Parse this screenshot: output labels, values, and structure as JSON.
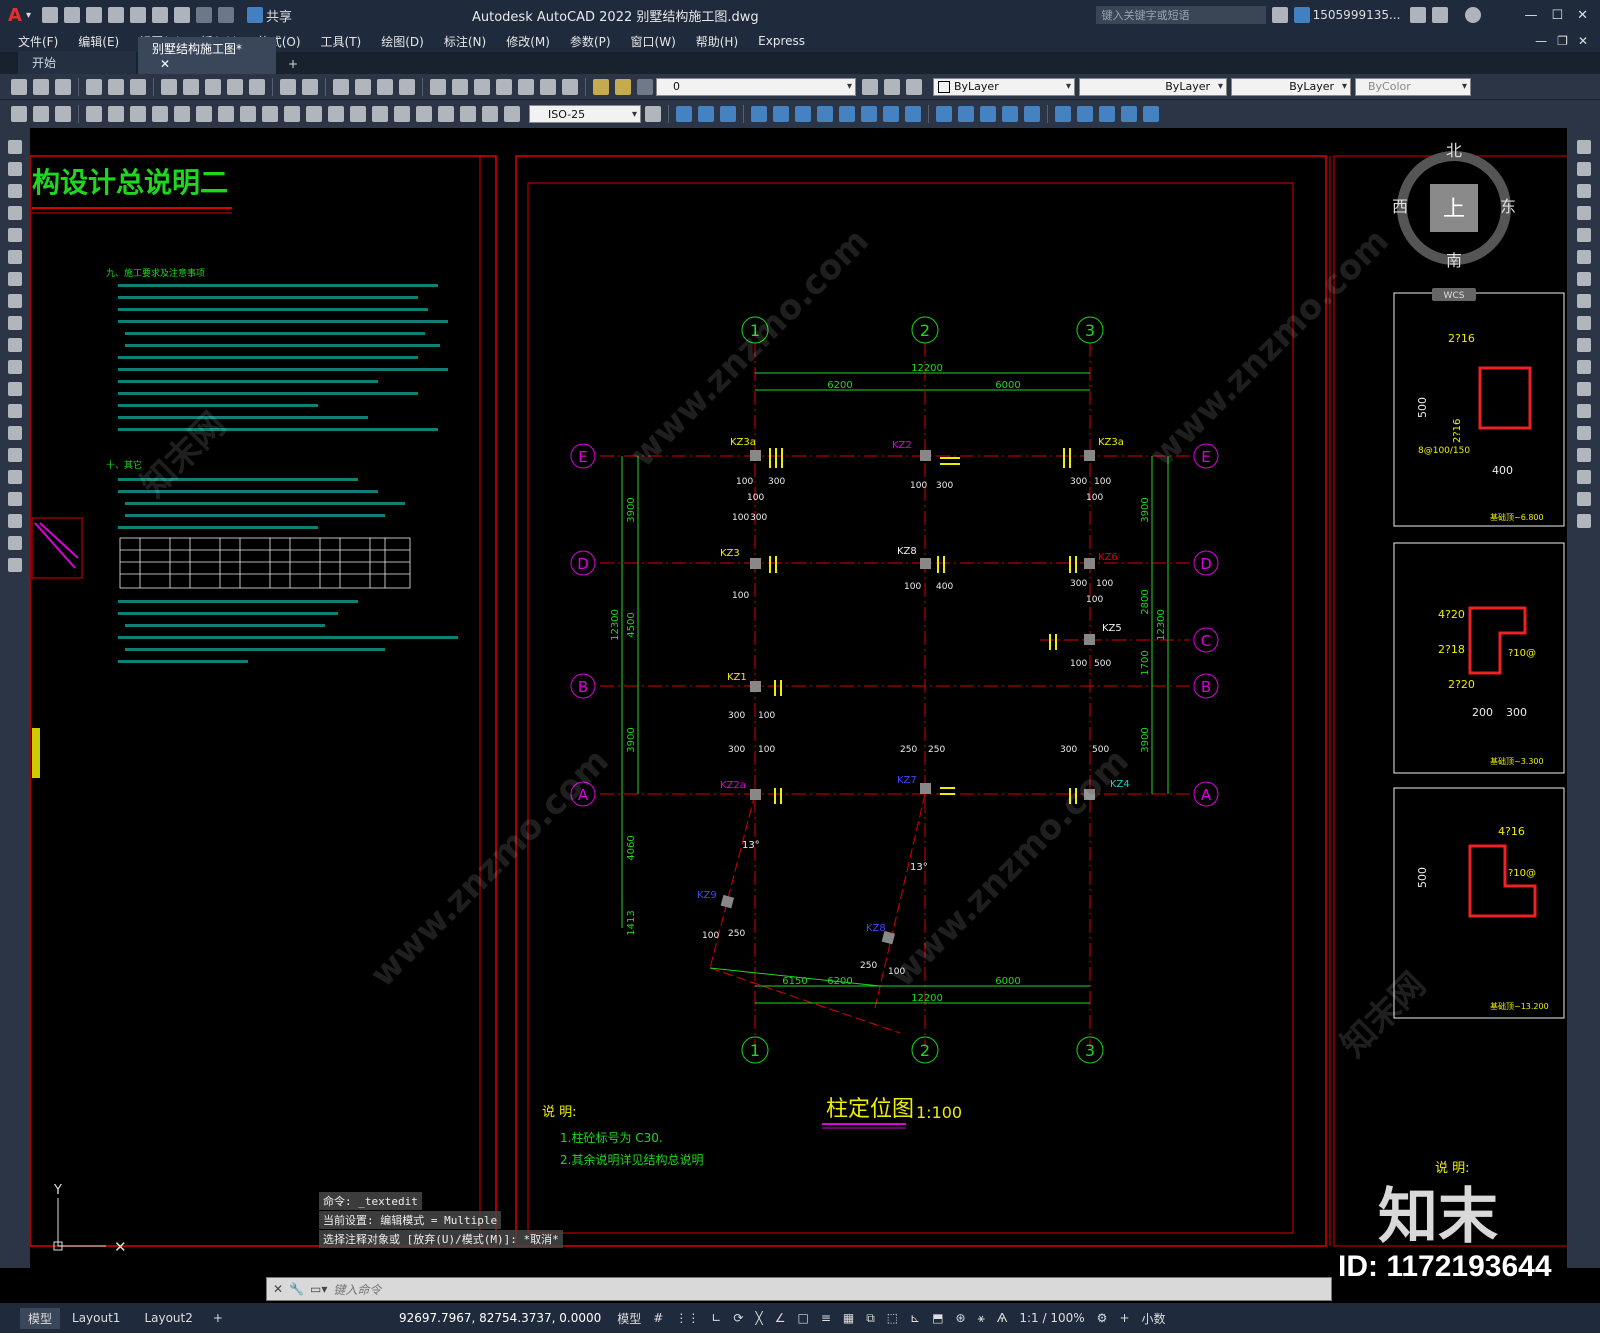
{
  "app": {
    "title": "Autodesk AutoCAD 2022    别墅结构施工图.dwg",
    "logo": "A",
    "share": "共享",
    "search_placeholder": "键入关键字或短语",
    "user": "1505999135..."
  },
  "menu": [
    "文件(F)",
    "编辑(E)",
    "视图(V)",
    "插入(I)",
    "格式(O)",
    "工具(T)",
    "绘图(D)",
    "标注(N)",
    "修改(M)",
    "参数(P)",
    "窗口(W)",
    "帮助(H)",
    "Express"
  ],
  "tabs": [
    "开始",
    "别墅结构施工图*"
  ],
  "toolbar": {
    "layer": "0",
    "color": "ByLayer",
    "linetype": "ByLayer",
    "lineweight": "ByLayer",
    "plotstyle": "ByColor",
    "dimstyle": "ISO-25"
  },
  "viewcube": {
    "north": "北",
    "south": "南",
    "east": "东",
    "west": "西",
    "top": "上",
    "wcs": "WCS"
  },
  "drawing": {
    "left_title": "构设计总说明二",
    "section9_title": "九、施工要求及注意事项",
    "section10_title": "十、其它",
    "plan_title": "柱定位图",
    "plan_scale": "1:100",
    "notes_title": "说 明:",
    "notes": [
      "1.柱砼标号为 C30.",
      "2.其余说明详见结构总说明"
    ],
    "right_notes_title": "说 明:",
    "grid_cols": [
      "1",
      "2",
      "3"
    ],
    "grid_rows": [
      "E",
      "D",
      "C",
      "B",
      "A"
    ],
    "dims_top": [
      "12200",
      "6200",
      "6000"
    ],
    "dims_bottom": [
      "6150",
      "6200",
      "6000",
      "12200"
    ],
    "dims_left": [
      "3900",
      "4500",
      "12300",
      "3900",
      "4060",
      "1413"
    ],
    "dims_right": [
      "3900",
      "2800",
      "12300",
      "1700",
      "3900"
    ],
    "columns": [
      "KZ3a",
      "KZ2",
      "KZ3a",
      "KZ3",
      "KZ8",
      "KZ6",
      "KZ5",
      "KZ1",
      "KZ2a",
      "KZ7",
      "KZ4",
      "KZ9",
      "KZ8"
    ],
    "detail_labels": [
      "2?16",
      "2?16",
      "400",
      "500",
      "8@100/150",
      "4?20",
      "2?18",
      "2?20",
      "?10@",
      "200",
      "300",
      "4?16",
      "?10@",
      "500"
    ],
    "elevations": [
      "基础顶~6.800",
      "基础顶~3.300",
      "基础顶~13.200"
    ],
    "angle": "13°"
  },
  "command": {
    "line1": "命令: _textedit",
    "line2": "当前设置: 编辑模式 = Multiple",
    "line3": "选择注释对象或 [放弃(U)/模式(M)]: *取消*",
    "placeholder": "键入命令"
  },
  "layouts": [
    "模型",
    "Layout1",
    "Layout2"
  ],
  "status": {
    "coords": "92697.7967, 82754.3737, 0.0000",
    "model": "模型",
    "scale": "1:1 / 100%",
    "units": "小数"
  },
  "watermark": {
    "brand": "知末",
    "id": "ID: 1172193644",
    "url": "www.znzmo.com",
    "text": "知末网"
  }
}
